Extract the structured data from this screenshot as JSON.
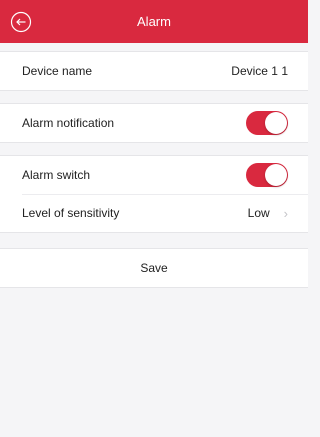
{
  "header": {
    "title": "Alarm",
    "back_icon": "back-arrow-circle-icon",
    "background_color": "#d9293f"
  },
  "device": {
    "label": "Device name",
    "value": "Device 1 1"
  },
  "notification": {
    "label": "Alarm notification",
    "enabled": true
  },
  "alarm": {
    "switch_label": "Alarm switch",
    "switch_enabled": true,
    "sensitivity_label": "Level of sensitivity",
    "sensitivity_value": "Low",
    "chevron_icon": "chevron-right-icon"
  },
  "actions": {
    "save_label": "Save"
  }
}
